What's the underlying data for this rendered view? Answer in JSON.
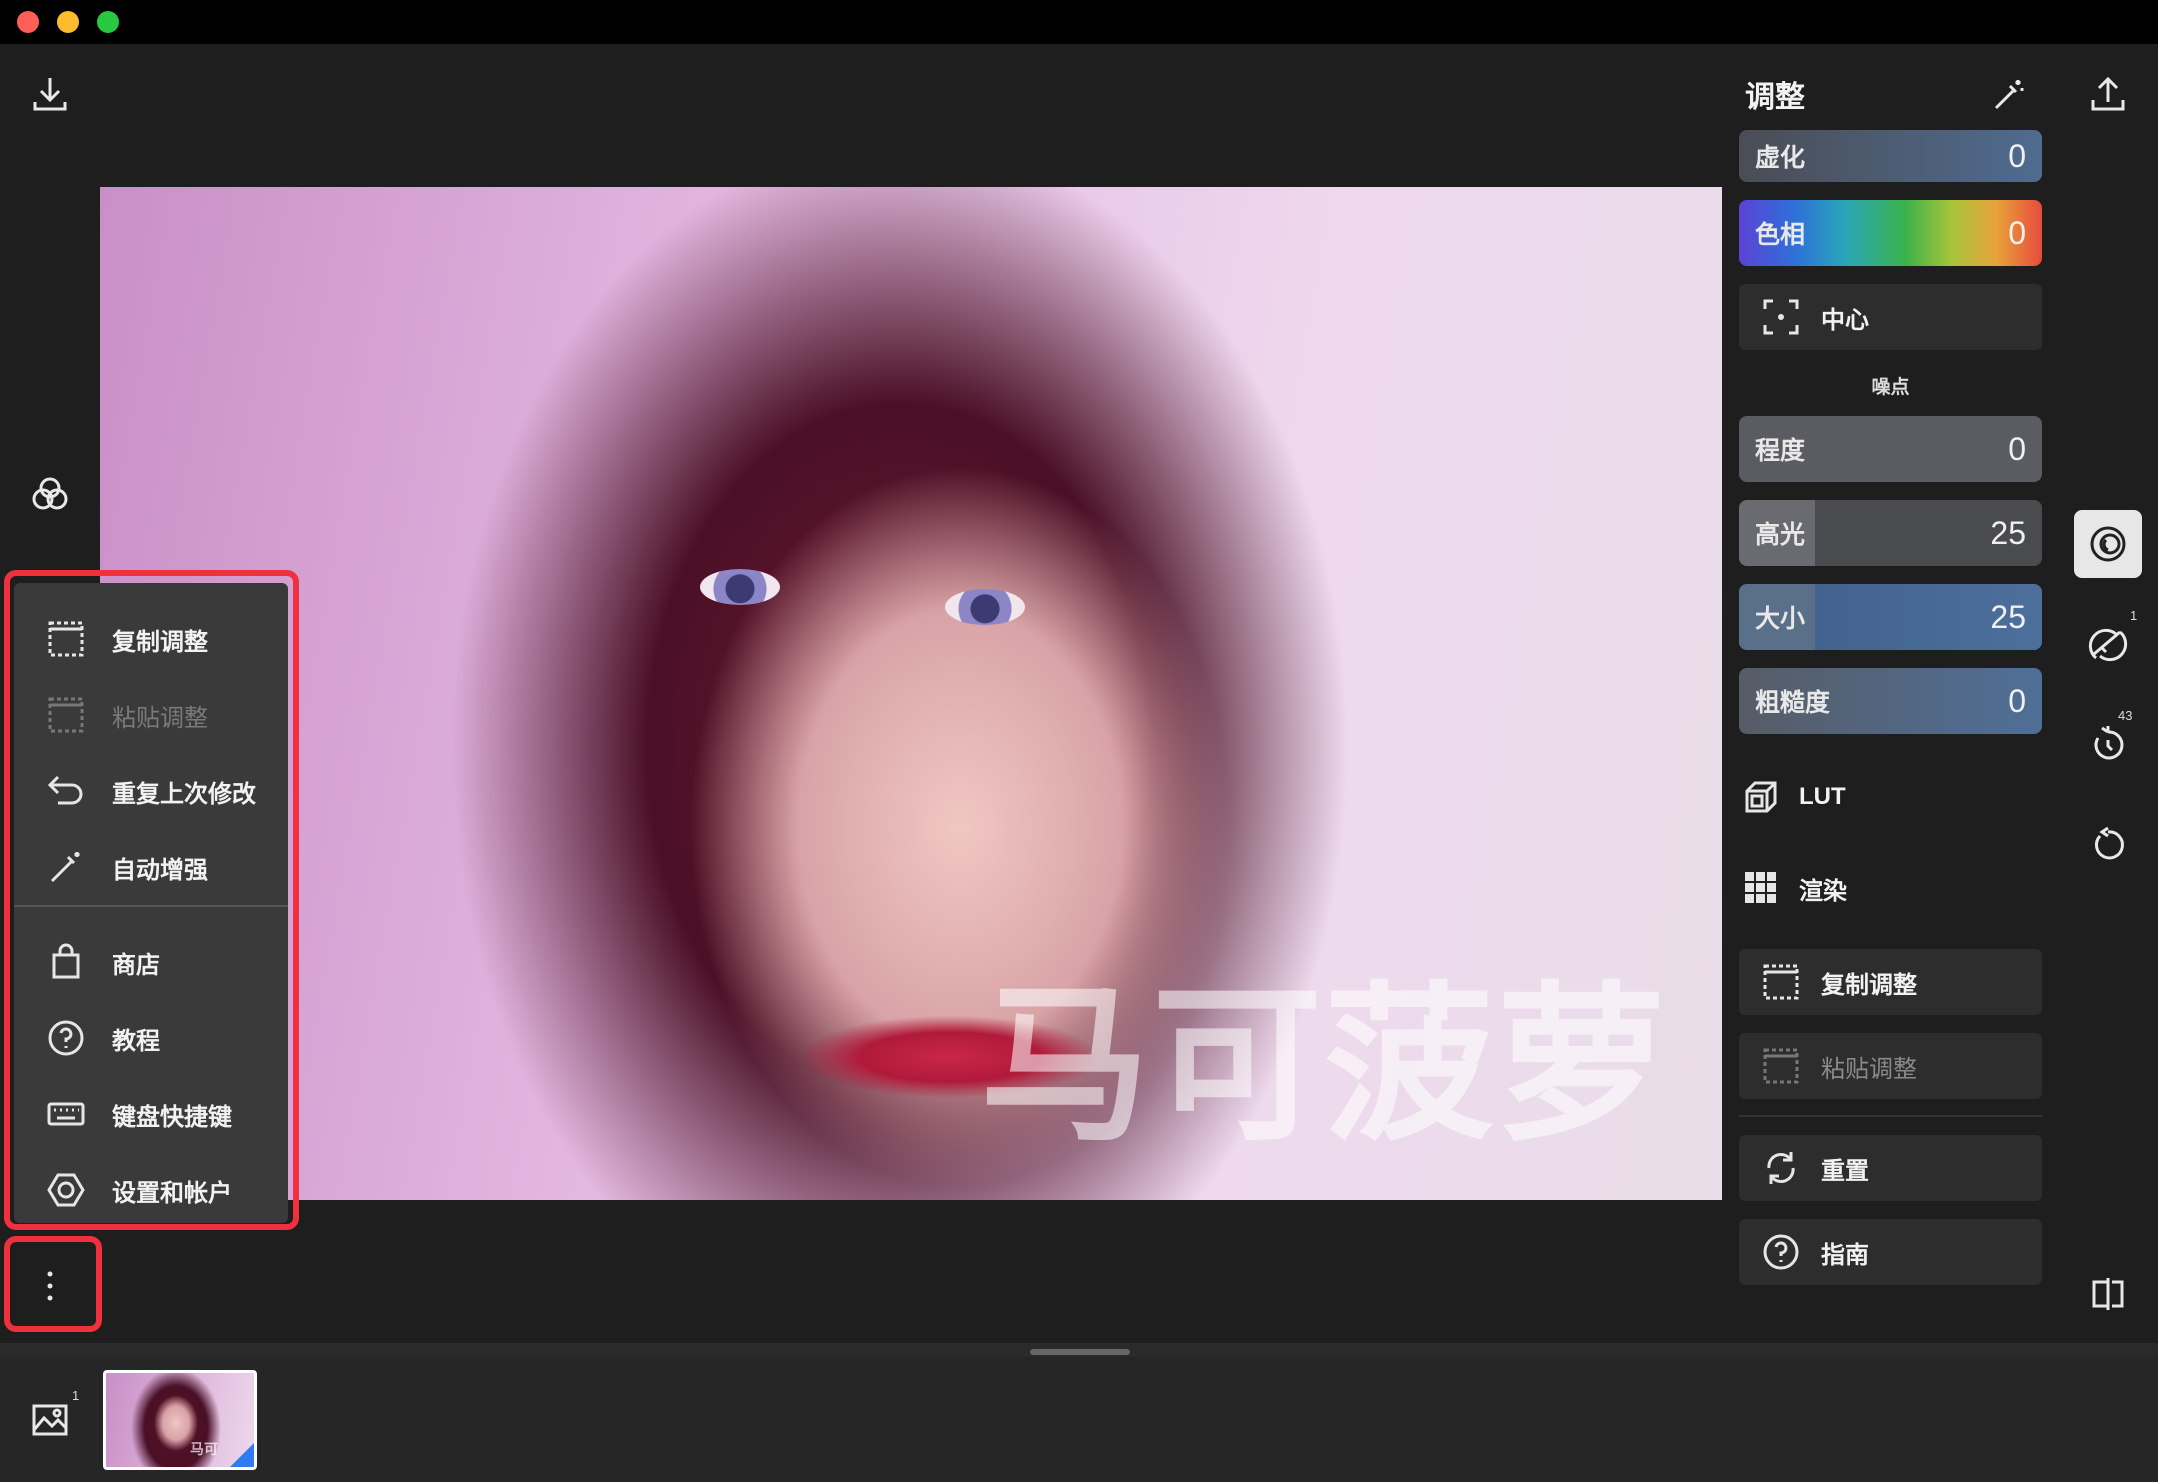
{
  "window": {
    "controls": [
      "close",
      "minimize",
      "zoom"
    ]
  },
  "toolbar": {
    "import_icon": "download-icon",
    "export_icon": "share-upload-icon",
    "auto_enhance_icon": "magic-wand-icon"
  },
  "left_tools": {
    "layers_icon": "color-circles-icon",
    "more_icon": "more-vertical-icon"
  },
  "menu": {
    "items": [
      {
        "label": "复制调整",
        "icon": "copy-adjust-icon",
        "enabled": true
      },
      {
        "label": "粘贴调整",
        "icon": "paste-adjust-icon",
        "enabled": false
      },
      {
        "label": "重复上次修改",
        "icon": "undo-arrow-icon",
        "enabled": true
      },
      {
        "label": "自动增强",
        "icon": "magic-wand-icon",
        "enabled": true
      },
      {
        "label": "商店",
        "icon": "shopping-bag-icon",
        "enabled": true
      },
      {
        "label": "教程",
        "icon": "question-circle-icon",
        "enabled": true
      },
      {
        "label": "键盘快捷键",
        "icon": "keyboard-icon",
        "enabled": true
      },
      {
        "label": "设置和帐户",
        "icon": "settings-hexagon-icon",
        "enabled": true
      }
    ]
  },
  "photo": {
    "watermark": "马可菠萝"
  },
  "panel": {
    "title": "调整",
    "sliders": {
      "blur": {
        "label": "虚化",
        "value": "0"
      },
      "hue": {
        "label": "色相",
        "value": "0"
      },
      "center": {
        "label": "中心"
      },
      "noise_section": "噪点",
      "amount": {
        "label": "程度",
        "value": "0",
        "fraction": 0.0
      },
      "highlights": {
        "label": "高光",
        "value": "25",
        "fraction": 0.25
      },
      "size": {
        "label": "大小",
        "value": "25",
        "fraction": 0.25
      },
      "roughness": {
        "label": "粗糙度",
        "value": "0",
        "fraction": 0.0
      }
    },
    "lut_label": "LUT",
    "render_label": "渲染",
    "buttons": {
      "copy": "复制调整",
      "paste": "粘贴调整",
      "reset": "重置",
      "guide": "指南"
    }
  },
  "right_tools": {
    "badges": {
      "heal": "1",
      "history": "43"
    }
  },
  "filmstrip": {
    "count": "1",
    "thumb_watermark": "马可"
  }
}
